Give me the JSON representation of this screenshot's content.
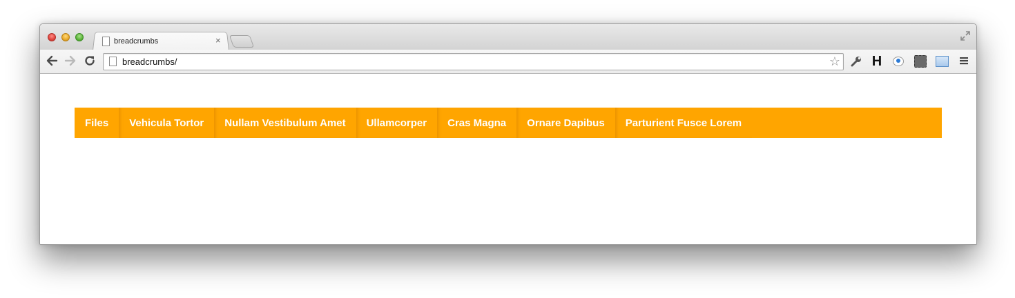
{
  "browser": {
    "tab_title": "breadcrumbs",
    "tab_close": "×",
    "url": "breadcrumbs/"
  },
  "icons": {
    "back": "arrow-left-icon",
    "forward": "arrow-right-icon",
    "reload": "reload-icon",
    "page": "page-icon",
    "bookmark": "star-icon",
    "wrench": "wrench-icon",
    "h_extension": "h-icon",
    "chat_extension": "chat-icon",
    "evernote_extension": "evernote-icon",
    "window_extension": "window-icon",
    "menu": "hamburger-menu-icon",
    "fullscreen": "fullscreen-icon"
  },
  "colors": {
    "breadcrumb_bg": "#ffa500",
    "breadcrumb_text": "#ffffff"
  },
  "breadcrumbs": {
    "items": [
      "Files",
      "Vehicula Tortor",
      "Nullam Vestibulum Amet",
      "Ullamcorper",
      "Cras Magna",
      "Ornare Dapibus",
      "Parturient Fusce Lorem"
    ]
  }
}
